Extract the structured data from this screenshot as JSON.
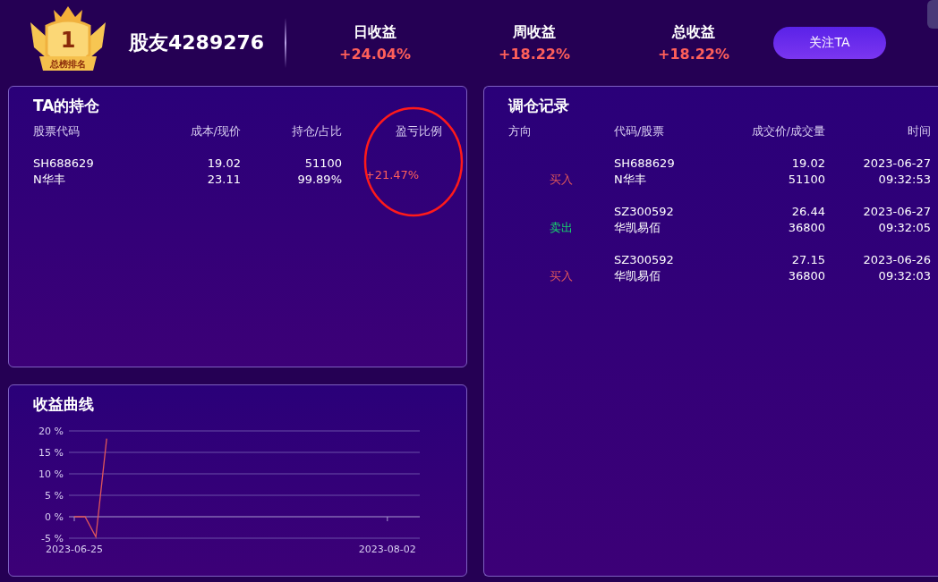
{
  "header": {
    "badge": {
      "rank": "1",
      "label": "总榜排名"
    },
    "username": "股友4289276",
    "stats": [
      {
        "label": "日收益",
        "value": "+24.04%"
      },
      {
        "label": "周收益",
        "value": "+18.22%"
      },
      {
        "label": "总收益",
        "value": "+18.22%"
      }
    ],
    "follow_button": "关注TA"
  },
  "holdings": {
    "title": "TA的持仓",
    "columns": [
      "股票代码",
      "成本/现价",
      "持仓/占比",
      "盈亏比例"
    ],
    "rows": [
      {
        "code": "SH688629",
        "name": "N华丰",
        "cost": "19.02",
        "price": "23.11",
        "shares": "51100",
        "ratio": "99.89%",
        "pnl": "+21.47%"
      }
    ]
  },
  "trades": {
    "title": "调仓记录",
    "columns": [
      "方向",
      "代码/股票",
      "成交价/成交量",
      "时间"
    ],
    "rows": [
      {
        "kind": "buy",
        "direction": "买入",
        "code": "SH688629",
        "name": "N华丰",
        "price": "19.02",
        "volume": "51100",
        "date": "2023-06-27",
        "time": "09:32:53"
      },
      {
        "kind": "sell",
        "direction": "卖出",
        "code": "SZ300592",
        "name": "华凯易佰",
        "price": "26.44",
        "volume": "36800",
        "date": "2023-06-27",
        "time": "09:32:05"
      },
      {
        "kind": "buy",
        "direction": "买入",
        "code": "SZ300592",
        "name": "华凯易佰",
        "price": "27.15",
        "volume": "36800",
        "date": "2023-06-26",
        "time": "09:32:03"
      }
    ]
  },
  "returns": {
    "title": "收益曲线",
    "chart_data": {
      "type": "line",
      "categories": [
        "2023-06-25",
        null,
        null,
        null,
        null,
        null,
        null,
        null,
        null,
        null,
        null,
        null,
        null,
        null,
        null,
        null,
        null,
        null,
        null,
        null,
        null,
        null,
        null,
        null,
        null,
        null,
        null,
        null,
        null,
        "2023-08-02",
        null,
        null,
        null
      ],
      "series": [
        {
          "color": "#e0565a",
          "values": [
            0,
            0,
            -4.7,
            18.2,
            null,
            null,
            null,
            null,
            null,
            null,
            null,
            null,
            null,
            null,
            null,
            null,
            null,
            null,
            null,
            null,
            null,
            null,
            null,
            null,
            null,
            null,
            null,
            null,
            null,
            null,
            null,
            null,
            null
          ]
        }
      ],
      "ylim": [
        -5,
        20
      ],
      "grid": true,
      "ref_lines": [
        {
          "axis": "y",
          "value": 0
        }
      ],
      "yticks": [
        {
          "value": -5,
          "label": "-5 %"
        },
        {
          "value": 0,
          "label": "0 %"
        },
        {
          "value": 5,
          "label": "5 %"
        },
        {
          "value": 10,
          "label": "10 %"
        },
        {
          "value": 15,
          "label": "15 %"
        },
        {
          "value": 20,
          "label": "20 %"
        }
      ]
    }
  }
}
